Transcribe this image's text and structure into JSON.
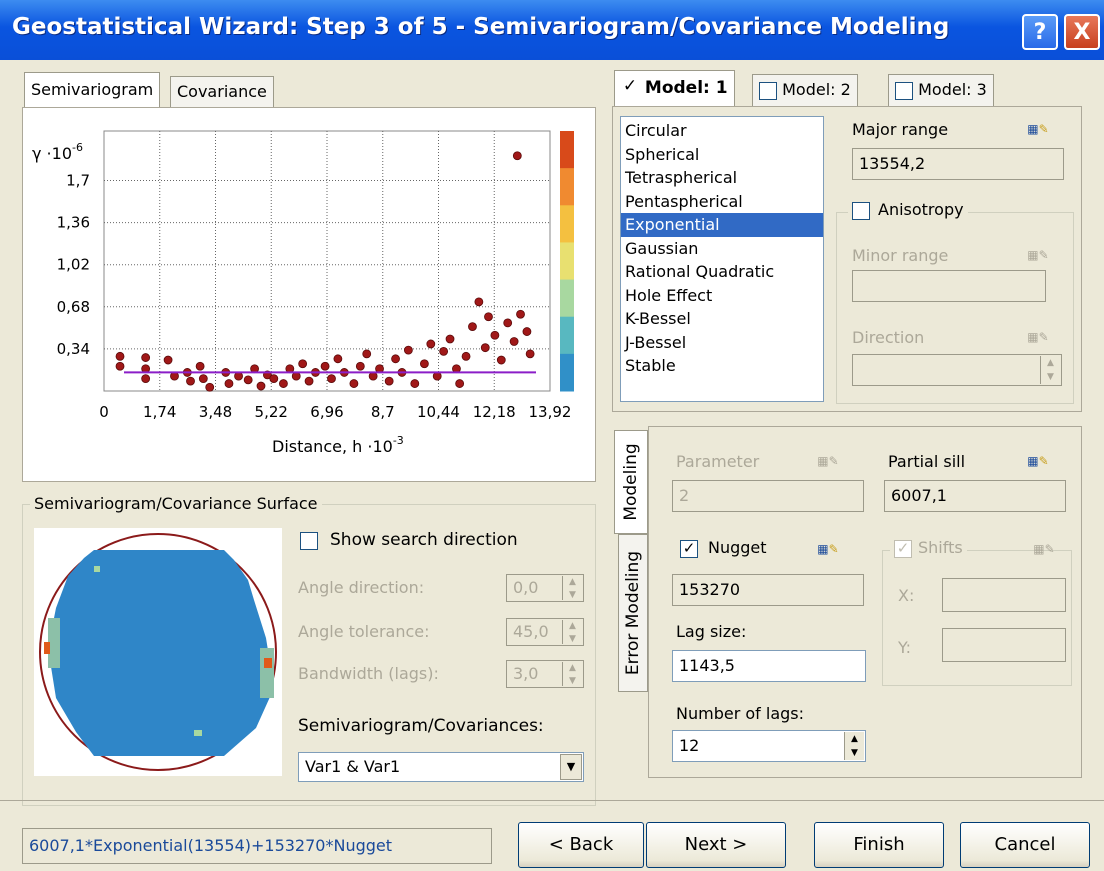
{
  "window": {
    "title": "Geostatistical Wizard: Step 3 of 5 - Semivariogram/Covariance Modeling"
  },
  "titlebar": {
    "help_label": "?",
    "close_label": "X"
  },
  "left_tabs": [
    "Semivariogram",
    "Covariance"
  ],
  "chart_data": {
    "type": "scatter",
    "ylabel": "γ ·10",
    "ylabel_exp": "-6",
    "xlabel": "Distance, h ·10",
    "xlabel_exp": "-3",
    "yticks": [
      "1,7",
      "1,36",
      "1,02",
      "0,68",
      "0,34"
    ],
    "xticks": [
      "0",
      "1,74",
      "3,48",
      "5,22",
      "6,96",
      "8,7",
      "10,44",
      "12,18",
      "13,92"
    ],
    "xlim": [
      0,
      13.92
    ],
    "ylim": [
      0,
      2.1
    ],
    "model_line": {
      "y": 0.15,
      "color": "#8b1ec8"
    },
    "series": [
      {
        "color": "#a01818",
        "points": [
          [
            0.5,
            0.28
          ],
          [
            0.5,
            0.2
          ],
          [
            1.3,
            0.27
          ],
          [
            1.3,
            0.18
          ],
          [
            1.3,
            0.1
          ],
          [
            2.0,
            0.25
          ],
          [
            2.2,
            0.12
          ],
          [
            2.6,
            0.15
          ],
          [
            2.7,
            0.08
          ],
          [
            3.0,
            0.2
          ],
          [
            3.1,
            0.1
          ],
          [
            3.3,
            0.03
          ],
          [
            3.8,
            0.15
          ],
          [
            3.9,
            0.06
          ],
          [
            4.2,
            0.12
          ],
          [
            4.5,
            0.09
          ],
          [
            4.7,
            0.18
          ],
          [
            4.9,
            0.04
          ],
          [
            5.1,
            0.13
          ],
          [
            5.3,
            0.1
          ],
          [
            5.6,
            0.06
          ],
          [
            5.8,
            0.18
          ],
          [
            6.0,
            0.12
          ],
          [
            6.2,
            0.22
          ],
          [
            6.4,
            0.08
          ],
          [
            6.6,
            0.15
          ],
          [
            6.9,
            0.2
          ],
          [
            7.1,
            0.1
          ],
          [
            7.3,
            0.26
          ],
          [
            7.5,
            0.15
          ],
          [
            7.8,
            0.06
          ],
          [
            8.0,
            0.2
          ],
          [
            8.2,
            0.3
          ],
          [
            8.4,
            0.12
          ],
          [
            8.6,
            0.18
          ],
          [
            8.9,
            0.08
          ],
          [
            9.1,
            0.26
          ],
          [
            9.3,
            0.15
          ],
          [
            9.5,
            0.33
          ],
          [
            9.7,
            0.06
          ],
          [
            10.0,
            0.22
          ],
          [
            10.2,
            0.38
          ],
          [
            10.4,
            0.12
          ],
          [
            10.6,
            0.32
          ],
          [
            10.8,
            0.42
          ],
          [
            11.0,
            0.18
          ],
          [
            11.1,
            0.06
          ],
          [
            11.3,
            0.28
          ],
          [
            11.5,
            0.52
          ],
          [
            11.7,
            0.72
          ],
          [
            11.9,
            0.35
          ],
          [
            12.0,
            0.6
          ],
          [
            12.2,
            0.45
          ],
          [
            12.4,
            0.25
          ],
          [
            12.6,
            0.55
          ],
          [
            12.8,
            0.4
          ],
          [
            13.0,
            0.62
          ],
          [
            13.2,
            0.48
          ],
          [
            13.3,
            0.3
          ],
          [
            12.9,
            1.9
          ]
        ]
      }
    ],
    "colorbar": [
      "#d84a1a",
      "#f08a30",
      "#f4c040",
      "#e8e070",
      "#a8d8a0",
      "#58b8c0",
      "#3090c8"
    ]
  },
  "surface": {
    "title": "Semivariogram/Covariance Surface",
    "show_search_direction": "Show search direction",
    "angle_direction_label": "Angle direction:",
    "angle_direction_value": "0,0",
    "angle_tolerance_label": "Angle tolerance:",
    "angle_tolerance_value": "45,0",
    "bandwidth_label": "Bandwidth (lags):",
    "bandwidth_value": "3,0",
    "semivar_label": "Semivariogram/Covariances:",
    "semivar_value": "Var1 & Var1"
  },
  "model_tabs": [
    "Model: 1",
    "Model: 2",
    "Model: 3"
  ],
  "model_types": [
    "Circular",
    "Spherical",
    "Tetraspherical",
    "Pentaspherical",
    "Exponential",
    "Gaussian",
    "Rational Quadratic",
    "Hole Effect",
    "K-Bessel",
    "J-Bessel",
    "Stable"
  ],
  "selected_model": "Exponential",
  "major_range": {
    "label": "Major range",
    "value": "13554,2"
  },
  "anisotropy": {
    "label": "Anisotropy"
  },
  "minor_range": {
    "label": "Minor range",
    "value": ""
  },
  "direction": {
    "label": "Direction",
    "value": ""
  },
  "side_tabs": [
    "Modeling",
    "Error Modeling"
  ],
  "parameter": {
    "label": "Parameter",
    "value": "2"
  },
  "partial_sill": {
    "label": "Partial sill",
    "value": "6007,1"
  },
  "nugget": {
    "label": "Nugget",
    "value": "153270"
  },
  "shifts": {
    "label": "Shifts",
    "x_label": "X:",
    "y_label": "Y:"
  },
  "lag_size": {
    "label": "Lag size:",
    "value": "1143,5"
  },
  "num_lags": {
    "label": "Number of lags:",
    "value": "12"
  },
  "formula": "6007,1*Exponential(13554)+153270*Nugget",
  "buttons": {
    "back": "< Back",
    "next": "Next >",
    "finish": "Finish",
    "cancel": "Cancel"
  }
}
